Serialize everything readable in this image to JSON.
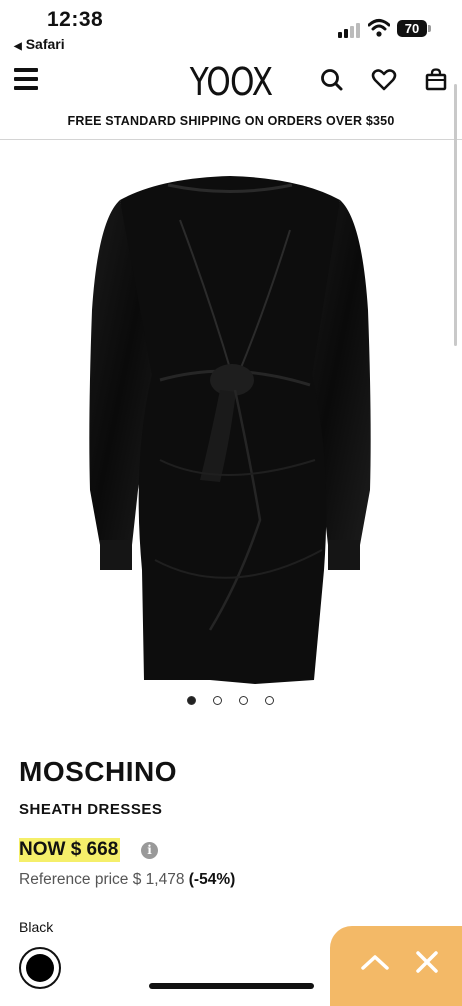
{
  "status_bar": {
    "time": "12:38",
    "back_app": "Safari",
    "battery": "70"
  },
  "header": {
    "logo": "YOOX",
    "icons": [
      "menu-icon",
      "search-icon",
      "heart-icon",
      "shopping-bag-icon"
    ]
  },
  "shipping_banner": "FREE STANDARD SHIPPING ON ORDERS OVER $350",
  "gallery": {
    "image_count": 4,
    "active_index": 0
  },
  "product": {
    "brand": "MOSCHINO",
    "category": "SHEATH DRESSES",
    "now_price": "NOW $ 668",
    "reference_label": "Reference price $ 1,478",
    "discount": "(-54%)",
    "color_label": "Black",
    "color_hex": "#000000"
  },
  "colors": {
    "price_highlight": "#f5ef6a",
    "float_panel": "#f3b967"
  }
}
